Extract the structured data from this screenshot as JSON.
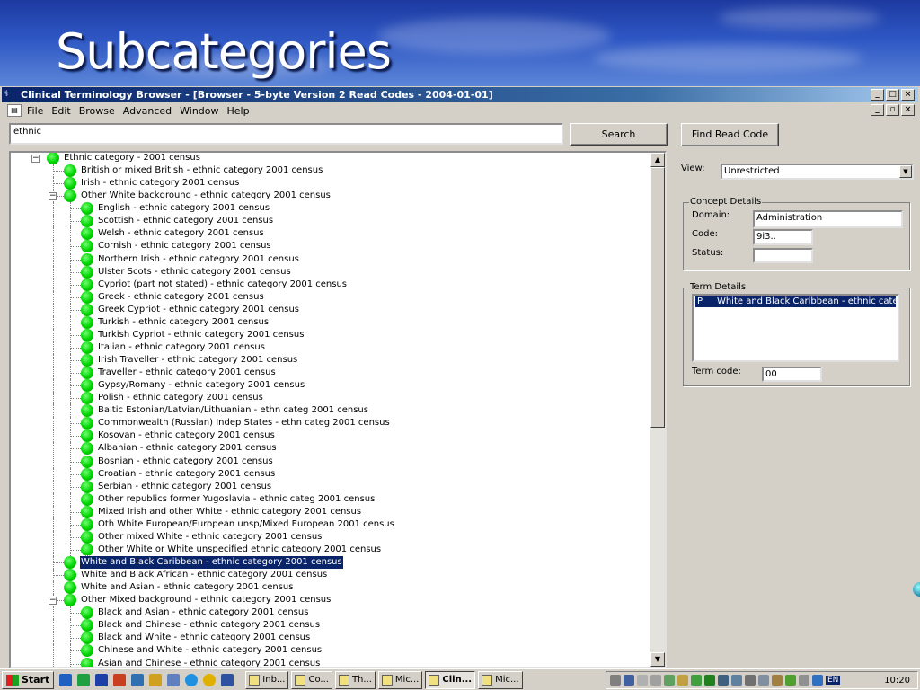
{
  "slide": {
    "title": "Subcategories"
  },
  "window": {
    "title": "Clinical Terminology Browser - [Browser - 5-byte Version 2 Read Codes - 2004-01-01]",
    "controls": {
      "minimize": "_",
      "maximize": "□",
      "close": "×"
    },
    "mdi_controls": {
      "minimize": "_",
      "restore": "▫",
      "close": "×"
    }
  },
  "menu": {
    "items": [
      "File",
      "Edit",
      "Browse",
      "Advanced",
      "Window",
      "Help"
    ]
  },
  "search": {
    "value": "ethnic",
    "button_label": "Search"
  },
  "find_button_label": "Find Read Code",
  "tree": {
    "rows": [
      {
        "label": "Ethnic category - 2001 census",
        "level": 0,
        "expander": "−"
      },
      {
        "label": "British or mixed British - ethnic category 2001 census",
        "level": 1
      },
      {
        "label": "Irish - ethnic category 2001 census",
        "level": 1
      },
      {
        "label": "Other White background - ethnic category 2001 census",
        "level": 1,
        "expander": "−"
      },
      {
        "label": "English - ethnic category 2001 census",
        "level": 2
      },
      {
        "label": "Scottish - ethnic category 2001 census",
        "level": 2
      },
      {
        "label": "Welsh - ethnic category 2001 census",
        "level": 2
      },
      {
        "label": "Cornish - ethnic category 2001 census",
        "level": 2
      },
      {
        "label": "Northern Irish - ethnic category 2001 census",
        "level": 2
      },
      {
        "label": "Ulster Scots - ethnic category 2001 census",
        "level": 2
      },
      {
        "label": "Cypriot (part not stated) - ethnic category 2001 census",
        "level": 2
      },
      {
        "label": "Greek - ethnic category 2001 census",
        "level": 2
      },
      {
        "label": "Greek Cypriot - ethnic category 2001 census",
        "level": 2
      },
      {
        "label": "Turkish - ethnic category 2001 census",
        "level": 2
      },
      {
        "label": "Turkish Cypriot - ethnic category 2001 census",
        "level": 2
      },
      {
        "label": "Italian - ethnic category 2001 census",
        "level": 2
      },
      {
        "label": "Irish Traveller - ethnic category 2001 census",
        "level": 2
      },
      {
        "label": "Traveller - ethnic category 2001 census",
        "level": 2
      },
      {
        "label": "Gypsy/Romany - ethnic category 2001 census",
        "level": 2
      },
      {
        "label": "Polish - ethnic category 2001 census",
        "level": 2
      },
      {
        "label": "Baltic Estonian/Latvian/Lithuanian - ethn categ 2001 census",
        "level": 2
      },
      {
        "label": "Commonwealth (Russian) Indep States - ethn categ 2001 census",
        "level": 2
      },
      {
        "label": "Kosovan - ethnic category 2001 census",
        "level": 2
      },
      {
        "label": "Albanian - ethnic category 2001 census",
        "level": 2
      },
      {
        "label": "Bosnian - ethnic category 2001 census",
        "level": 2
      },
      {
        "label": "Croatian - ethnic category 2001 census",
        "level": 2
      },
      {
        "label": "Serbian - ethnic category 2001 census",
        "level": 2
      },
      {
        "label": "Other republics former Yugoslavia - ethnic categ 2001 census",
        "level": 2
      },
      {
        "label": "Mixed Irish and other White - ethnic category 2001 census",
        "level": 2
      },
      {
        "label": "Oth White European/European unsp/Mixed European 2001 census",
        "level": 2
      },
      {
        "label": "Other mixed White - ethnic category 2001 census",
        "level": 2
      },
      {
        "label": "Other White or White unspecified ethnic category 2001 census",
        "level": 2
      },
      {
        "label": "White and Black Caribbean - ethnic category 2001 census",
        "level": 1,
        "selected": true
      },
      {
        "label": "White and Black African - ethnic category 2001 census",
        "level": 1
      },
      {
        "label": "White and Asian - ethnic category 2001 census",
        "level": 1
      },
      {
        "label": "Other Mixed background - ethnic category 2001 census",
        "level": 1,
        "expander": "−"
      },
      {
        "label": "Black and Asian - ethnic category 2001 census",
        "level": 2
      },
      {
        "label": "Black and Chinese - ethnic category 2001 census",
        "level": 2
      },
      {
        "label": "Black and White - ethnic category 2001 census",
        "level": 2
      },
      {
        "label": "Chinese and White - ethnic category 2001 census",
        "level": 2
      },
      {
        "label": "Asian and Chinese - ethnic category 2001 census",
        "level": 2
      }
    ]
  },
  "view": {
    "label": "View:",
    "value": "Unrestricted"
  },
  "concept_details": {
    "title": "Concept Details",
    "domain_label": "Domain:",
    "domain_value": "Administration",
    "code_label": "Code:",
    "code_value": "9i3..",
    "status_label": "Status:",
    "status_value": ""
  },
  "term_details": {
    "title": "Term Details",
    "selected_term_prefix": "P",
    "selected_term": "White and Black Caribbean - ethnic categ",
    "term_code_label": "Term code:",
    "term_code_value": "00"
  },
  "taskbar": {
    "start_label": "Start",
    "tasks": [
      "Inb...",
      "Co...",
      "Th...",
      "Mic...",
      "Clin...",
      "Mic..."
    ],
    "active_index": 4,
    "language": "EN",
    "clock": "10:20"
  },
  "colors": {
    "node": "#00d400",
    "selection": "#0a246a",
    "titlebar": "#0a246a"
  }
}
